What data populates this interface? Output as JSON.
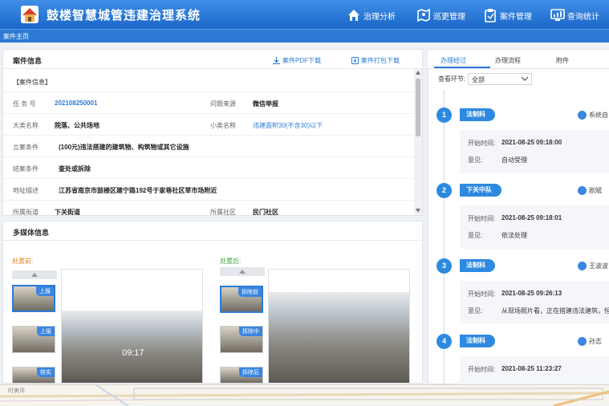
{
  "header": {
    "app_title": "鼓楼智慧城管违建治理系统",
    "nav": [
      {
        "label": "治理分析",
        "icon": "home-icon"
      },
      {
        "label": "巡更管理",
        "icon": "map-icon"
      },
      {
        "label": "案件管理",
        "icon": "clipboard-icon"
      },
      {
        "label": "查询统计",
        "icon": "stats-icon"
      }
    ],
    "subtab": "案件主页"
  },
  "case_info": {
    "title": "案件信息",
    "pdf_download": "案件PDF下载",
    "zip_download": "案件打包下载",
    "section": "【案件信息】",
    "fields": {
      "task_no_label": "任 务 号",
      "task_no": "202108250001",
      "source_label": "问题来源",
      "source": "微信举报",
      "category_label": "大类名称",
      "category": "院落、公共场地",
      "subcategory_label": "小类名称",
      "subcategory": "违建面积30(不含30)以下",
      "filing_label": "立案条件",
      "filing": "(100元)违法搭建的建筑物、构筑物或其它设施",
      "closing_label": "结案条件",
      "closing": "查处或拆除",
      "address_label": "地址描述",
      "address": "江苏省南京市鼓楼区建宁路192号于家巷社区草市场附近",
      "street_label": "所属街道",
      "street": "下关街道",
      "community_label": "所属社区",
      "community": "民门社区"
    }
  },
  "media": {
    "title": "多媒体信息",
    "before_label": "处置前:",
    "after_label": "处置后:",
    "before_tags": [
      "上报",
      "上报",
      "核实"
    ],
    "after_tags": [
      "拆除前",
      "拆除中",
      "拆除后"
    ],
    "timestamp": "09:17",
    "colors": {
      "before": "#e8821e",
      "after": "#3aa63a"
    }
  },
  "process": {
    "tabs": [
      "办理经过",
      "办理流程",
      "附件"
    ],
    "filter_label": "查看环节:",
    "filter_value": "全部",
    "start_label": "开始时间:",
    "opinion_label": "意见:",
    "steps": [
      {
        "num": "1",
        "dept": "法制科",
        "person": "系统自",
        "time": "2021-08-25 09:18:00",
        "opinion": "自动受理"
      },
      {
        "num": "2",
        "dept": "下关中队",
        "person": "剧斌",
        "time": "2021-08-25 09:18:01",
        "opinion": "依法处理"
      },
      {
        "num": "3",
        "dept": "法制科",
        "person": "王波波",
        "time": "2021-08-25 09:26:13",
        "opinion": "从现场照片看，正在搭建违法建筑，恒"
      },
      {
        "num": "4",
        "dept": "法制科",
        "person": "孙志",
        "time": "2021-08-25 11:23:27",
        "opinion": ""
      }
    ]
  },
  "map": {
    "label": "时美坪"
  }
}
